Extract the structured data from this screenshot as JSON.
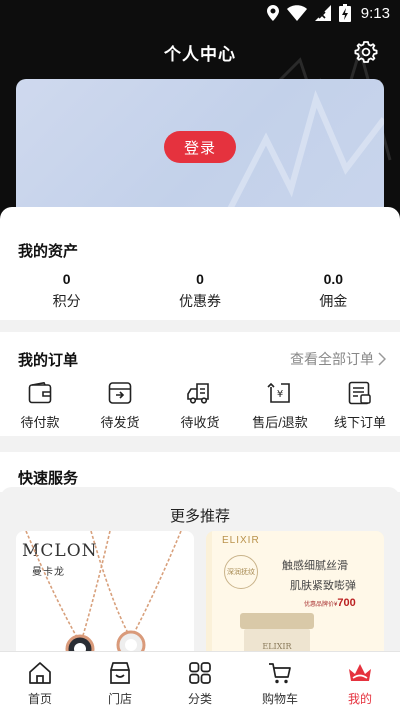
{
  "status_bar": {
    "time": "9:13"
  },
  "header": {
    "title": "个人中心"
  },
  "login": {
    "button_label": "登录"
  },
  "assets": {
    "title": "我的资产",
    "items": [
      {
        "value": "0",
        "label": "积分"
      },
      {
        "value": "0",
        "label": "优惠券"
      },
      {
        "value": "0.0",
        "label": "佣金"
      }
    ]
  },
  "orders": {
    "title": "我的订单",
    "view_all": "查看全部订单",
    "items": [
      {
        "label": "待付款",
        "icon": "wallet-icon"
      },
      {
        "label": "待发货",
        "icon": "package-icon"
      },
      {
        "label": "待收货",
        "icon": "truck-icon"
      },
      {
        "label": "售后/退款",
        "icon": "refund-icon"
      },
      {
        "label": "线下订单",
        "icon": "offline-order-icon"
      }
    ]
  },
  "quick_services": {
    "title": "快速服务"
  },
  "recommend": {
    "title": "更多推荐",
    "products": [
      {
        "brand": "MCLON",
        "brand_sub": "曼卡龙"
      },
      {
        "brand": "ELIXIR",
        "badge": "深润抚纹",
        "line1": "触感细腻丝滑",
        "line2": "肌肤紧致嘭弹",
        "price_label": "优惠品牌价¥",
        "price": "700"
      }
    ]
  },
  "tabbar": {
    "items": [
      {
        "label": "首页",
        "icon": "home-icon"
      },
      {
        "label": "门店",
        "icon": "store-icon"
      },
      {
        "label": "分类",
        "icon": "category-icon"
      },
      {
        "label": "购物车",
        "icon": "cart-icon"
      },
      {
        "label": "我的",
        "icon": "profile-crown-icon",
        "active": true
      }
    ]
  },
  "colors": {
    "accent": "#e5323e",
    "header_bg": "#0d0d0d",
    "card_bg": "#c8d5ec"
  }
}
